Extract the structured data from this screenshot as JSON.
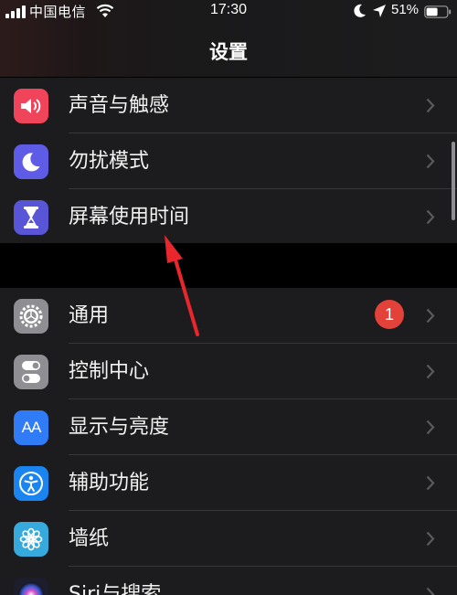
{
  "status_bar": {
    "carrier": "中国电信",
    "time": "17:30",
    "battery": "51%"
  },
  "nav": {
    "title": "设置"
  },
  "group1": [
    {
      "label": "声音与触感",
      "icon": "speaker-icon",
      "color": "#f0445a"
    },
    {
      "label": "勿扰模式",
      "icon": "moon-icon",
      "color": "#5e5ce6"
    },
    {
      "label": "屏幕使用时间",
      "icon": "hourglass-icon",
      "color": "#5856d6"
    }
  ],
  "group2": [
    {
      "label": "通用",
      "icon": "gear-icon",
      "color": "#8e8e93",
      "badge": "1"
    },
    {
      "label": "控制中心",
      "icon": "toggles-icon",
      "color": "#8e8e93"
    },
    {
      "label": "显示与亮度",
      "icon": "text-size-icon",
      "color": "#2f7cf6",
      "icon_text": "AA"
    },
    {
      "label": "辅助功能",
      "icon": "accessibility-icon",
      "color": "#1a84f0"
    },
    {
      "label": "墙纸",
      "icon": "flower-icon",
      "color": "#36aadc"
    },
    {
      "label": "Siri与搜索",
      "icon": "siri-icon",
      "color": "#1d1d2e"
    }
  ],
  "colors": {
    "background": "#000000",
    "cell": "#1c1c1e",
    "separator": "#38383a",
    "badge": "#e2423a",
    "annotation_arrow": "#e8262b"
  }
}
